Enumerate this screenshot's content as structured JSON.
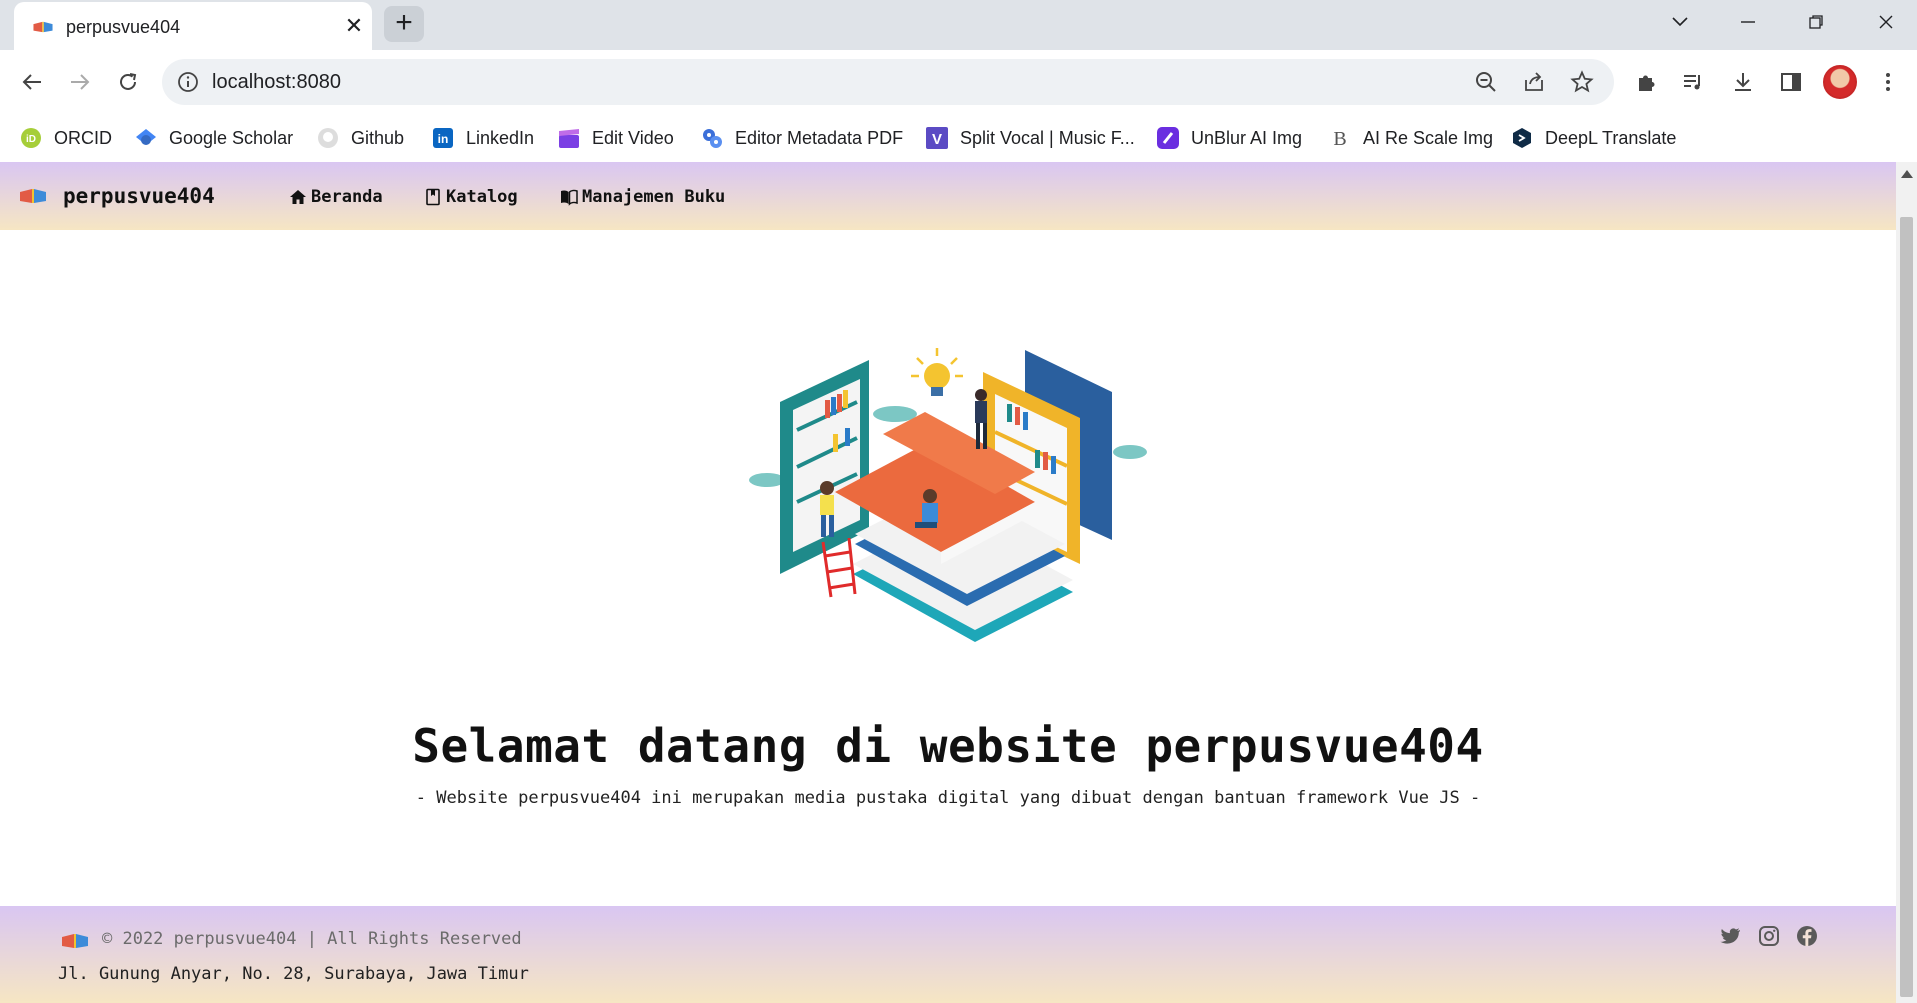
{
  "browser": {
    "tab_title": "perpusvue404",
    "tab_close": "✕",
    "new_tab": "+",
    "window_controls": [
      "chevron-down-icon",
      "minimize-icon",
      "restore-icon",
      "close-icon"
    ],
    "url": "localhost:8080",
    "bookmarks": [
      {
        "label": "ORCID",
        "icon": "orcid-icon",
        "color": "#a6ce39"
      },
      {
        "label": "Google Scholar",
        "icon": "google-scholar-icon",
        "color": "#4285f4"
      },
      {
        "label": "Github",
        "icon": "github-icon",
        "color": "#24292e"
      },
      {
        "label": "LinkedIn",
        "icon": "linkedin-icon",
        "color": "#0a66c2"
      },
      {
        "label": "Edit Video",
        "icon": "clapperboard-icon",
        "color": "#7b3fe4"
      },
      {
        "label": "Editor Metadata PDF",
        "icon": "gears-icon",
        "color": "#3b6fd9"
      },
      {
        "label": "Split Vocal | Music F...",
        "icon": "v-logo-icon",
        "color": "#5b4bc4"
      },
      {
        "label": "UnBlur AI Img",
        "icon": "unblur-icon",
        "color": "#6a2ee0"
      },
      {
        "label": "AI Re Scale Img",
        "icon": "b-logo-icon",
        "color": "#333333"
      },
      {
        "label": "DeepL Translate",
        "icon": "deepl-icon",
        "color": "#0f2b46"
      }
    ]
  },
  "navbar": {
    "brand": "perpusvue404",
    "links": [
      {
        "label": "Beranda",
        "icon": "home-icon"
      },
      {
        "label": "Katalog",
        "icon": "bookmark-book-icon"
      },
      {
        "label": "Manajemen Buku",
        "icon": "open-book-icon"
      }
    ]
  },
  "hero": {
    "image": "library-illustration",
    "title": "Selamat datang di website perpusvue404",
    "subtitle": "- Website perpusvue404 ini merupakan media pustaka digital yang dibuat dengan bantuan framework Vue JS -"
  },
  "footer": {
    "copyright": "© 2022 perpusvue404 | All Rights Reserved",
    "address": "Jl. Gunung Anyar, No. 28, Surabaya, Jawa Timur",
    "social": [
      "twitter-icon",
      "instagram-icon",
      "facebook-icon"
    ]
  },
  "colors": {
    "gradient_top": "#d9c6f2",
    "gradient_bottom": "#f6e6c3",
    "tabstrip": "#dfe3e8",
    "omnibox": "#eef1f4"
  }
}
